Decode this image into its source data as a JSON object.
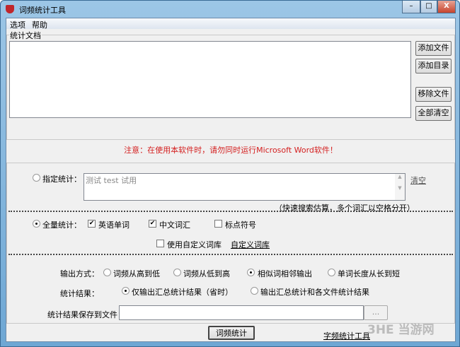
{
  "window": {
    "title": "词频统计工具",
    "minimize": "–",
    "maximize": "□",
    "close": "X"
  },
  "menu": [
    "选项",
    "帮助"
  ],
  "documents": {
    "group_label": "统计文档",
    "buttons": [
      "添加文件",
      "添加目录",
      "移除文件",
      "全部清空"
    ]
  },
  "warning": "注意：在使用本软件时，请勿同时运行Microsoft Word软件！",
  "specified": {
    "label": "指定统计：",
    "value": "测试 test 试用",
    "clear_link": "清空",
    "hint": "（快速搜索估算，多个词汇以空格分开）",
    "selected": false
  },
  "full": {
    "label": "全量统计：",
    "selected": true,
    "options": [
      {
        "label": "英语单词",
        "checked": true
      },
      {
        "label": "中文词汇",
        "checked": true
      },
      {
        "label": "标点符号",
        "checked": false
      }
    ],
    "custom_dict": {
      "label": "使用自定义词库",
      "checked": false
    },
    "custom_dict_link": "自定义词库"
  },
  "output": {
    "label": "输出方式：",
    "options": [
      {
        "label": "词频从高到低",
        "selected": false
      },
      {
        "label": "词频从低到高",
        "selected": false
      },
      {
        "label": "相似词相邻输出",
        "selected": true
      },
      {
        "label": "单词长度从长到短",
        "selected": false
      }
    ]
  },
  "result": {
    "label": "统计结果：",
    "options": [
      {
        "label": "仅输出汇总统计结果（省时）",
        "selected": true
      },
      {
        "label": "输出汇总统计和各文件统计结果",
        "selected": false
      }
    ]
  },
  "save": {
    "label": "统计结果保存到文件：",
    "value": "",
    "browse": "..."
  },
  "footer": {
    "run_button": "词频统计",
    "char_tool_link": "字频统计工具"
  },
  "watermark": "3HE 当游网",
  "colors": {
    "warning": "#d42020",
    "title_bar": "#7fb3dc"
  }
}
